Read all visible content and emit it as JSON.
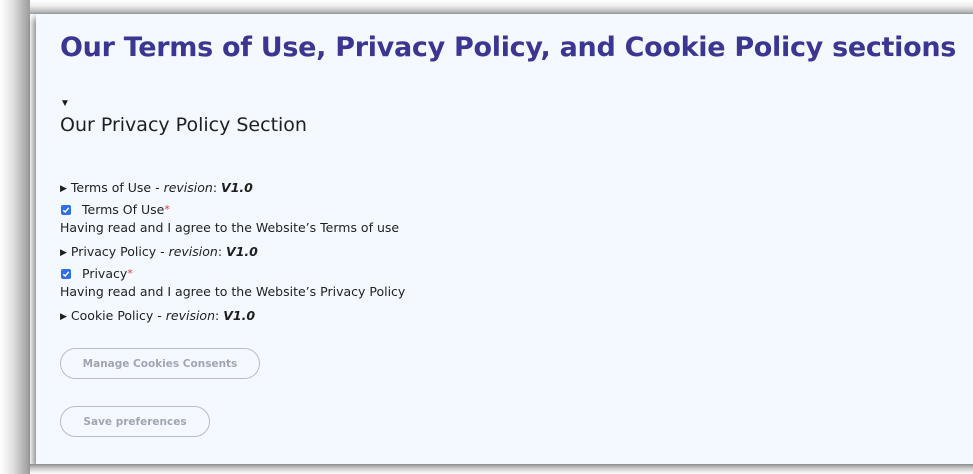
{
  "page": {
    "title": "Our Terms of Use, Privacy Policy, and Cookie Policy sections"
  },
  "privacy_section": {
    "heading": "Our Privacy Policy Section",
    "items": [
      {
        "type": "summary",
        "label": "Terms of Use",
        "separator": " - ",
        "revision_word": "revision",
        "revision_colon": ": ",
        "revision_value": "V1.0"
      },
      {
        "type": "checkbox",
        "label": "Terms Of Use",
        "required_mark": "*",
        "checked": true,
        "description": "Having read and I agree to the Website’s Terms of use"
      },
      {
        "type": "summary",
        "label": "Privacy Policy",
        "separator": " - ",
        "revision_word": "revision",
        "revision_colon": ": ",
        "revision_value": "V1.0"
      },
      {
        "type": "checkbox",
        "label": "Privacy",
        "required_mark": "*",
        "checked": true,
        "description": "Having read and I agree to the Website’s Privacy Policy"
      },
      {
        "type": "summary",
        "label": "Cookie Policy",
        "separator": " - ",
        "revision_word": "revision",
        "revision_colon": ": ",
        "revision_value": "V1.0"
      }
    ]
  },
  "buttons": {
    "manage_cookies": "Manage Cookies Consents",
    "save_preferences": "Save preferences"
  },
  "icons": {
    "open_disclosure": "▼",
    "closed_disclosure": "▶"
  },
  "colors": {
    "title": "#3b3691",
    "checkbox": "#2f6fe4",
    "required": "#e03c3c",
    "panel_bg": "#f4f9ff",
    "button_border": "#b7bccb"
  }
}
